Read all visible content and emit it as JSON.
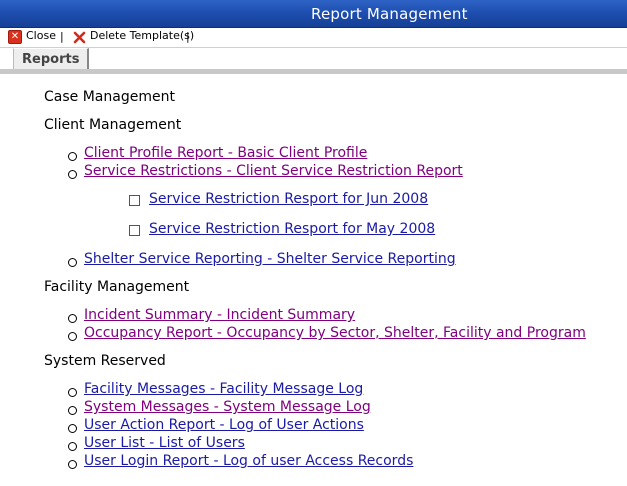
{
  "window": {
    "title": "Report Management"
  },
  "toolbar": {
    "close_label": "Close",
    "separator": "|",
    "delete_label": "Delete Template(s)",
    "delete_trailing_separator": "|"
  },
  "tabs": [
    {
      "label": "Reports"
    }
  ],
  "sections": {
    "case_management": {
      "heading": "Case Management"
    },
    "client_management": {
      "heading": "Client Management",
      "items": [
        {
          "label": "Client Profile Report - Basic Client Profile",
          "visited": true
        },
        {
          "label": "Service Restrictions - Client Service Restriction Report",
          "visited": true
        },
        {
          "label": "Shelter Service Reporting - Shelter Service Reporting",
          "visited": false
        }
      ],
      "sub_items": [
        {
          "label": "Service Restriction Resport for Jun 2008",
          "checked": false
        },
        {
          "label": "Service Restriction Resport for May 2008",
          "checked": false
        }
      ]
    },
    "facility_management": {
      "heading": "Facility Management",
      "items": [
        {
          "label": "Incident Summary - Incident Summary",
          "visited": true
        },
        {
          "label": "Occupancy Report - Occupancy by Sector, Shelter, Facility and Program",
          "visited": true
        }
      ]
    },
    "system_reserved": {
      "heading": "System Reserved",
      "items": [
        {
          "label": "Facility Messages - Facility Message Log",
          "visited": false
        },
        {
          "label": "System Messages - System Message Log",
          "visited": true
        },
        {
          "label": "User Action Report - Log of User Actions",
          "visited": false
        },
        {
          "label": "User List - List of Users",
          "visited": false
        },
        {
          "label": "User Login Report - Log of user Access Records",
          "visited": false
        }
      ]
    }
  },
  "colors": {
    "titlebar": "#1e4fb0",
    "link": "#1a1aa6",
    "visited_link": "#800080",
    "tab_bg": "#eeeeee"
  }
}
